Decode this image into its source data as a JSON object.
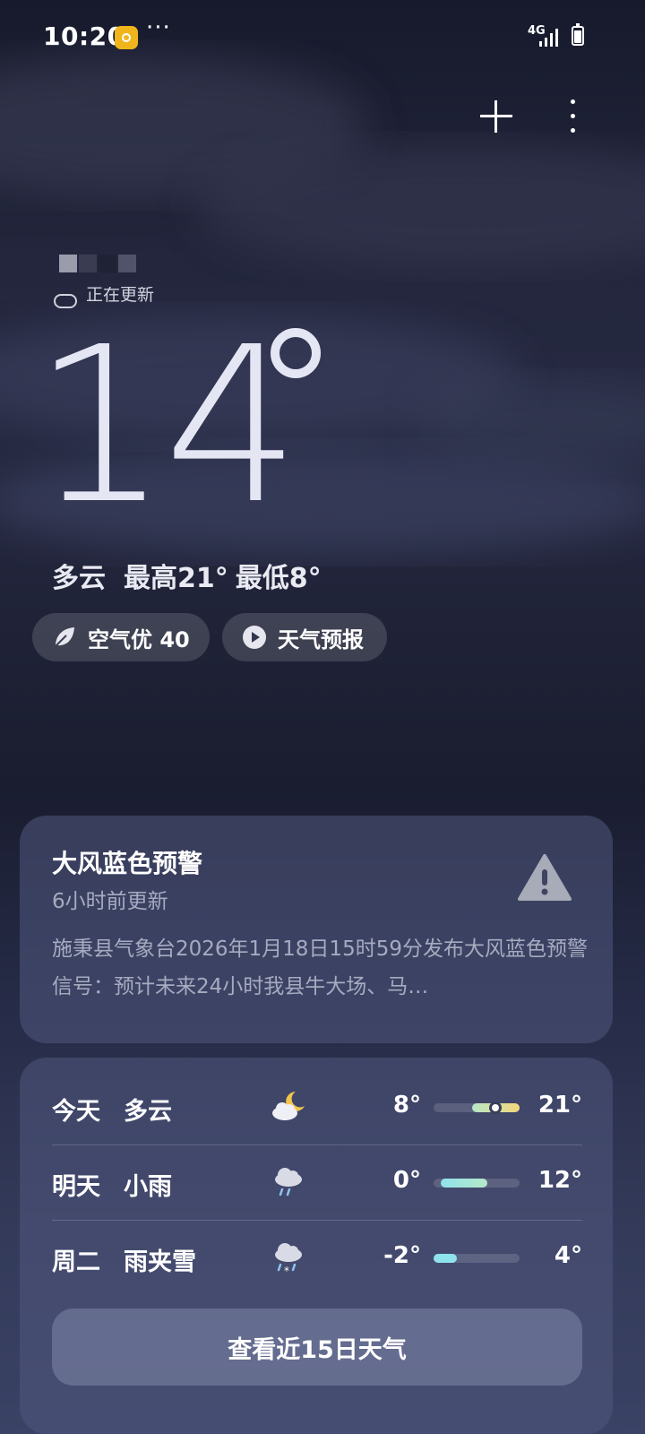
{
  "status_bar": {
    "time": "10:20",
    "dots": "···",
    "network": "4G"
  },
  "current": {
    "updating": "正在更新",
    "temperature": "14",
    "condition": "多云",
    "high": "最高21°",
    "low": "最低8°",
    "air_quality": "空气优 40",
    "forecast_video": "天气预报"
  },
  "alert": {
    "title": "大风蓝色预警",
    "updated": "6小时前更新",
    "body": "施秉县气象台2026年1月18日15时59分发布大风蓝色预警信号：预计未来24小时我县牛大场、马…"
  },
  "forecast": {
    "days": [
      {
        "day": "今天",
        "desc": "多云",
        "icon": "cloudy-night-icon",
        "low": "8°",
        "high": "21°",
        "range_start": 0.45,
        "range_end": 1.0,
        "current_pos": 0.7
      },
      {
        "day": "明天",
        "desc": "小雨",
        "icon": "light-rain-icon",
        "low": "0°",
        "high": "12°",
        "range_start": 0.0,
        "range_end": 0.6
      },
      {
        "day": "周二",
        "desc": "雨夹雪",
        "icon": "sleet-icon",
        "low": "-2°",
        "high": "4°",
        "range_start": 0.0,
        "range_end": 0.25
      }
    ],
    "more_button": "查看近15日天气"
  },
  "colors": {
    "warning_grey": "#a8abb8",
    "bar_green": "#b7e8c8",
    "bar_yellow": "#f3d67a",
    "bar_cyan": "#8fe3ec"
  }
}
